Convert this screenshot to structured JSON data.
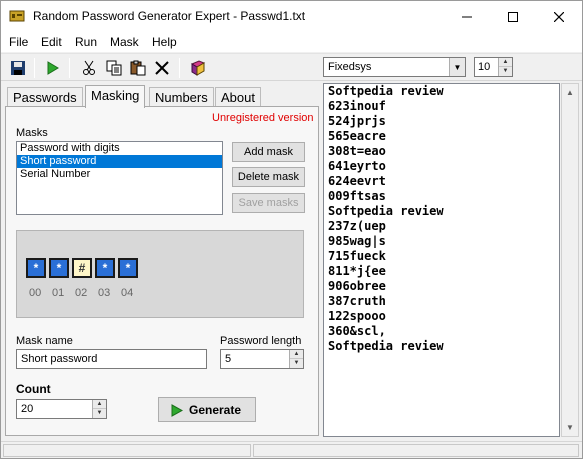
{
  "window": {
    "title": "Random Password Generator Expert - Passwd1.txt"
  },
  "menu": [
    "File",
    "Edit",
    "Run",
    "Mask",
    "Help"
  ],
  "toolbar": {
    "font_name": "Fixedsys",
    "font_size": "10",
    "icons": [
      "save-icon",
      "run-icon",
      "cut-icon",
      "copy-icon",
      "paste-icon",
      "delete-icon",
      "book-icon"
    ]
  },
  "tabs": [
    {
      "label": "Passwords",
      "active": false
    },
    {
      "label": "Masking",
      "active": true
    },
    {
      "label": "Numbers",
      "active": false
    },
    {
      "label": "About",
      "active": false
    }
  ],
  "masking": {
    "unregistered": "Unregistered version",
    "masks_label": "Masks",
    "masks": [
      "Password with digits",
      "Short password",
      "Serial Number"
    ],
    "selected_mask_index": 1,
    "add_mask": "Add mask",
    "delete_mask": "Delete mask",
    "save_masks": "Save masks",
    "preview_chars": [
      "*",
      "*",
      "#",
      "*",
      "*"
    ],
    "preview_indexes": [
      "00",
      "01",
      "02",
      "03",
      "04"
    ],
    "mask_name_label": "Mask name",
    "mask_name": "Short password",
    "password_length_label": "Password length",
    "password_length": "5",
    "count_label": "Count",
    "count": "20",
    "generate": "Generate"
  },
  "output_lines": [
    "Softpedia review",
    "623inouf",
    "524jprjs",
    "565eacre",
    "308t=eao",
    "641eyrto",
    "624eevrt",
    "009ftsas",
    "Softpedia review",
    "237z(uep",
    "985wag|s",
    "715fueck",
    "811*j{ee",
    "906obree",
    "387cruth",
    "122spooo",
    "360&scl,",
    "Softpedia review"
  ],
  "colors": {
    "selection": "#0078d7",
    "unregistered": "#e00000"
  }
}
